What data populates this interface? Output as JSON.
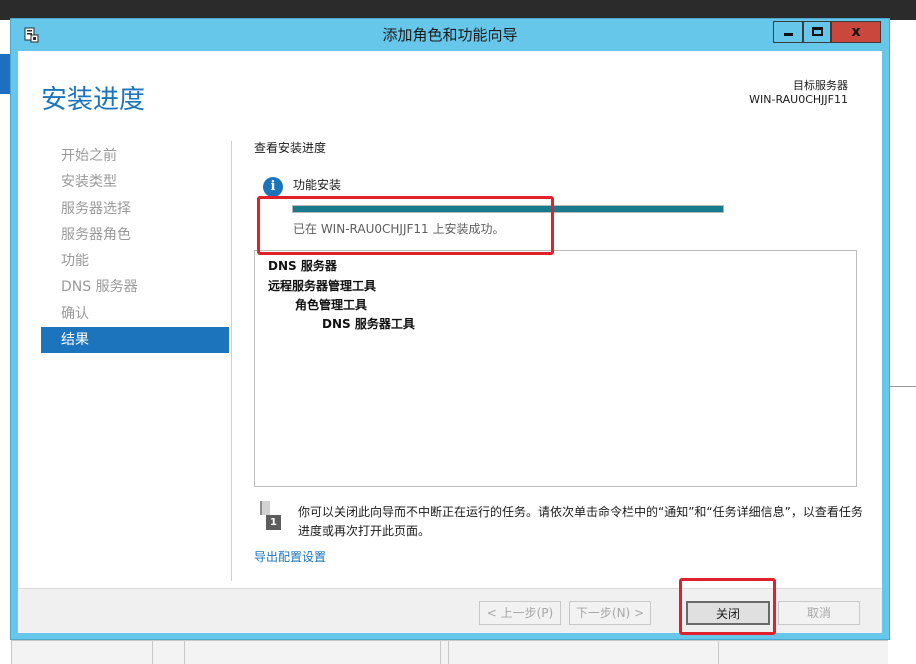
{
  "window": {
    "title": "添加角色和功能向导",
    "close_glyph": "x"
  },
  "page": {
    "title": "安装进度",
    "target_server_label": "目标服务器",
    "target_server_name": "WIN-RAU0CHJJF11"
  },
  "nav": {
    "items": [
      {
        "label": "开始之前",
        "active": false
      },
      {
        "label": "安装类型",
        "active": false
      },
      {
        "label": "服务器选择",
        "active": false
      },
      {
        "label": "服务器角色",
        "active": false
      },
      {
        "label": "功能",
        "active": false
      },
      {
        "label": "DNS 服务器",
        "active": false
      },
      {
        "label": "确认",
        "active": false
      },
      {
        "label": "结果",
        "active": true
      }
    ]
  },
  "main": {
    "section_label": "查看安装进度",
    "feature_install_label": "功能安装",
    "progress_fraction": 1.0,
    "status_text": "已在 WIN-RAU0CHJJF11 上安装成功。",
    "results": [
      {
        "text": "DNS 服务器",
        "indent": 0
      },
      {
        "text": "远程服务器管理工具",
        "indent": 0
      },
      {
        "text": "角色管理工具",
        "indent": 1
      },
      {
        "text": "DNS 服务器工具",
        "indent": 2
      }
    ],
    "note_icon_number": "1",
    "note_text": "你可以关闭此向导而不中断正在运行的任务。请依次单击命令栏中的“通知”和“任务详细信息”，以查看任务进度或再次打开此页面。",
    "export_link": "导出配置设置"
  },
  "footer": {
    "prev_label": "< 上一步(P)",
    "next_label": "下一步(N) >",
    "close_label": "关闭",
    "cancel_label": "取消"
  },
  "colors": {
    "accent": "#1c75bc",
    "titlebar": "#66c7ea",
    "progress_fill": "#187a8c",
    "annotation_red": "#e0202a"
  }
}
